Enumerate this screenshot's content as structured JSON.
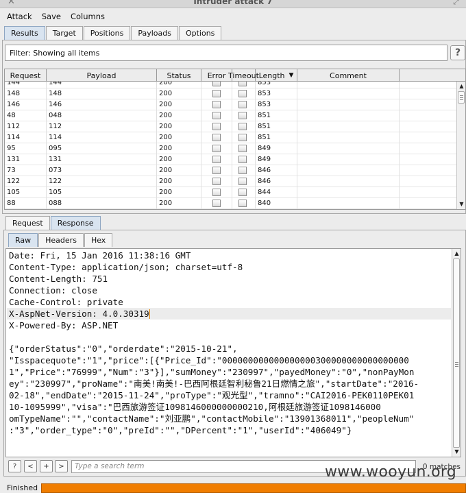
{
  "window": {
    "title": "Intruder attack 7"
  },
  "menu": [
    "Attack",
    "Save",
    "Columns"
  ],
  "main_tabs": [
    "Results",
    "Target",
    "Positions",
    "Payloads",
    "Options"
  ],
  "filter": {
    "text": "Filter:  Showing all items"
  },
  "help_label": "?",
  "table": {
    "columns": [
      "Request",
      "Payload",
      "Status",
      "Error",
      "Timeout",
      "Length",
      "Comment"
    ],
    "sort_indicator": "▼",
    "rows": [
      [
        "144",
        "144",
        "200",
        "853"
      ],
      [
        "148",
        "148",
        "200",
        "853"
      ],
      [
        "146",
        "146",
        "200",
        "853"
      ],
      [
        "48",
        "048",
        "200",
        "851"
      ],
      [
        "112",
        "112",
        "200",
        "851"
      ],
      [
        "114",
        "114",
        "200",
        "851"
      ],
      [
        "95",
        "095",
        "200",
        "849"
      ],
      [
        "131",
        "131",
        "200",
        "849"
      ],
      [
        "73",
        "073",
        "200",
        "846"
      ],
      [
        "122",
        "122",
        "200",
        "846"
      ],
      [
        "105",
        "105",
        "200",
        "844"
      ],
      [
        "88",
        "088",
        "200",
        "840"
      ]
    ]
  },
  "detail_tabs": [
    "Request",
    "Response"
  ],
  "view_tabs": [
    "Raw",
    "Headers",
    "Hex"
  ],
  "response_lines": [
    "Date: Fri, 15 Jan 2016 11:38:16 GMT",
    "Content-Type: application/json; charset=utf-8",
    "Content-Length: 751",
    "Connection: close",
    "Cache-Control: private",
    "X-AspNet-Version: 4.0.30319",
    "X-Powered-By: ASP.NET",
    "",
    "{\"orderStatus\":\"0\",\"orderdate\":\"2015-10-21\",",
    "\"Isspacequote\":\"1\",\"price\":[{\"Price_Id\":\"000000000000000000300000000000000000",
    "1\",\"Price\":\"76999\",\"Num\":\"3\"}],\"sumMoney\":\"230997\",\"payedMoney\":\"0\",\"nonPayMon",
    "ey\":\"230997\",\"proName\":\"南美!南美!-巴西阿根廷智利秘鲁21日燃情之旅\",\"startDate\":\"2016-",
    "02-18\",\"endDate\":\"2015-11-24\",\"proType\":\"观光型\",\"tramno\":\"CAI2016-PEK0110PEK01",
    "10-1095999\",\"visa\":\"巴西旅游签证1098146000000000210,阿根廷旅游签证1098146000",
    "omTypeName\":\"\",\"contactName\":\"刘亚鹏\",\"contactMobile\":\"13901368011\",\"peopleNum\"",
    ":\"3\",\"order_type\":\"0\",\"preId\":\"\",\"DPercent\":\"1\",\"userId\":\"406049\"}"
  ],
  "nav_buttons": [
    "?",
    "<",
    "+",
    ">"
  ],
  "search": {
    "placeholder": "Type a search term",
    "matches": "0 matches"
  },
  "status": {
    "text": "Finished",
    "progress": 1.0
  },
  "watermark": "www.wooyun.org"
}
